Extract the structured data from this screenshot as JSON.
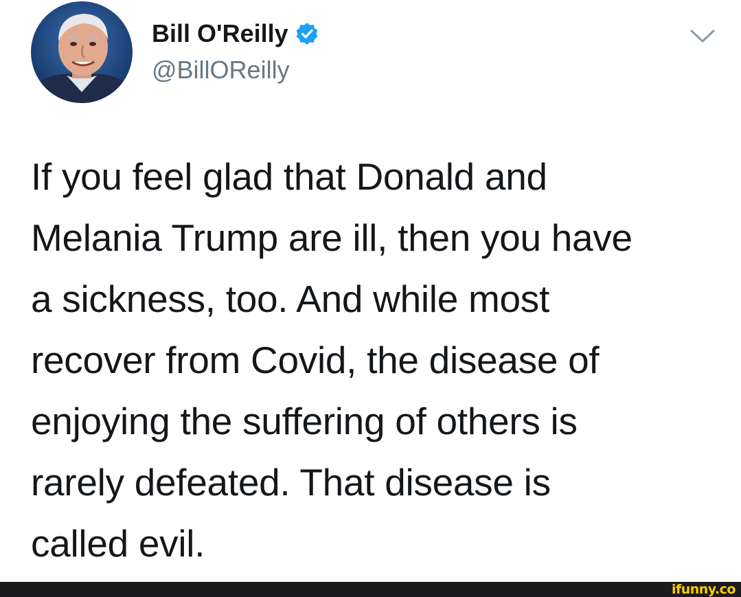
{
  "tweet": {
    "author": {
      "name": "Bill O'Reilly",
      "handle": "@BillOReilly",
      "verified": true,
      "avatar_icon": "profile-photo"
    },
    "menu_icon": "chevron-down-icon",
    "text_lines": [
      "If you feel glad that Donald and",
      "Melania Trump are ill, then you have",
      "a sickness, too. And while most",
      "recover from Covid, the disease of",
      "enjoying the suffering of others is",
      "rarely defeated. That disease is",
      "called evil."
    ]
  },
  "watermark": {
    "text": "ifunny.co"
  },
  "colors": {
    "verified_badge": "#1da1f2",
    "handle": "#657786",
    "text": "#14171a",
    "footer_bar": "#1b1b1d",
    "watermark": "#ffcc00"
  }
}
